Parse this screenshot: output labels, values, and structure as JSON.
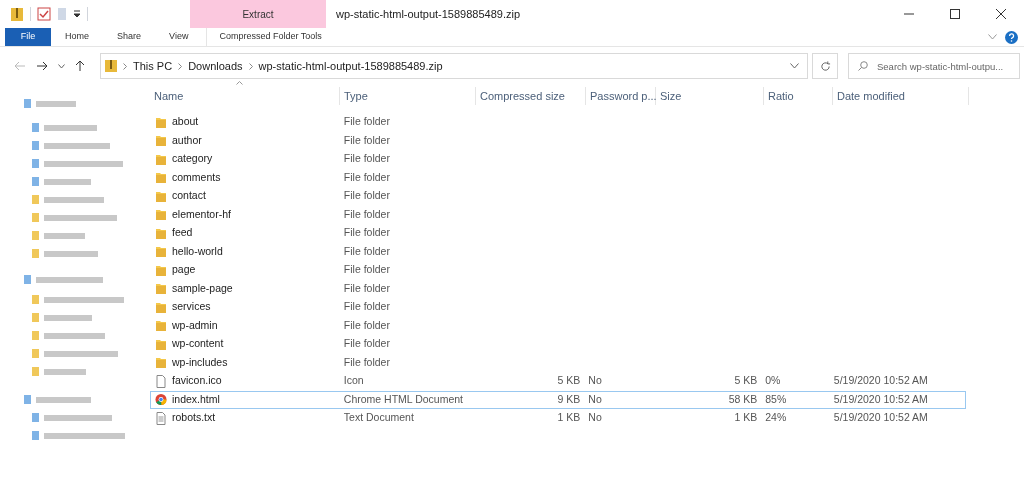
{
  "window": {
    "title": "wp-static-html-output-1589885489.zip",
    "context_tab": "Extract"
  },
  "ribbon_tabs": [
    {
      "label": "File",
      "selected": true
    },
    {
      "label": "Home",
      "selected": false
    },
    {
      "label": "Share",
      "selected": false
    },
    {
      "label": "View",
      "selected": false
    },
    {
      "label": "Compressed Folder Tools",
      "selected": false
    }
  ],
  "breadcrumb": [
    "This PC",
    "Downloads",
    "wp-static-html-output-1589885489.zip"
  ],
  "search": {
    "placeholder": "Search wp-static-html-outpu..."
  },
  "table": {
    "columns": [
      "Name",
      "Type",
      "Compressed size",
      "Password p...",
      "Size",
      "Ratio",
      "Date modified"
    ],
    "rows": [
      {
        "kind": "folder",
        "name": "about",
        "type": "File folder",
        "focused": false
      },
      {
        "kind": "folder",
        "name": "author",
        "type": "File folder",
        "focused": false
      },
      {
        "kind": "folder",
        "name": "category",
        "type": "File folder",
        "focused": false
      },
      {
        "kind": "folder",
        "name": "comments",
        "type": "File folder",
        "focused": false
      },
      {
        "kind": "folder",
        "name": "contact",
        "type": "File folder",
        "focused": false
      },
      {
        "kind": "folder",
        "name": "elementor-hf",
        "type": "File folder",
        "focused": false
      },
      {
        "kind": "folder",
        "name": "feed",
        "type": "File folder",
        "focused": false
      },
      {
        "kind": "folder",
        "name": "hello-world",
        "type": "File folder",
        "focused": false
      },
      {
        "kind": "folder",
        "name": "page",
        "type": "File folder",
        "focused": false
      },
      {
        "kind": "folder",
        "name": "sample-page",
        "type": "File folder",
        "focused": false
      },
      {
        "kind": "folder",
        "name": "services",
        "type": "File folder",
        "focused": false
      },
      {
        "kind": "folder",
        "name": "wp-admin",
        "type": "File folder",
        "focused": false
      },
      {
        "kind": "folder",
        "name": "wp-content",
        "type": "File folder",
        "focused": false
      },
      {
        "kind": "folder",
        "name": "wp-includes",
        "type": "File folder",
        "focused": false
      },
      {
        "kind": "file",
        "name": "favicon.ico",
        "type": "Icon",
        "compressed": "5 KB",
        "password": "No",
        "size": "5 KB",
        "ratio": "0%",
        "date": "5/19/2020 10:52 AM",
        "focused": false
      },
      {
        "kind": "browser",
        "name": "index.html",
        "type": "Chrome HTML Document",
        "compressed": "9 KB",
        "password": "No",
        "size": "58 KB",
        "ratio": "85%",
        "date": "5/19/2020 10:52 AM",
        "focused": true
      },
      {
        "kind": "text",
        "name": "robots.txt",
        "type": "Text Document",
        "compressed": "1 KB",
        "password": "No",
        "size": "1 KB",
        "ratio": "24%",
        "date": "5/19/2020 10:52 AM",
        "focused": false
      }
    ]
  }
}
